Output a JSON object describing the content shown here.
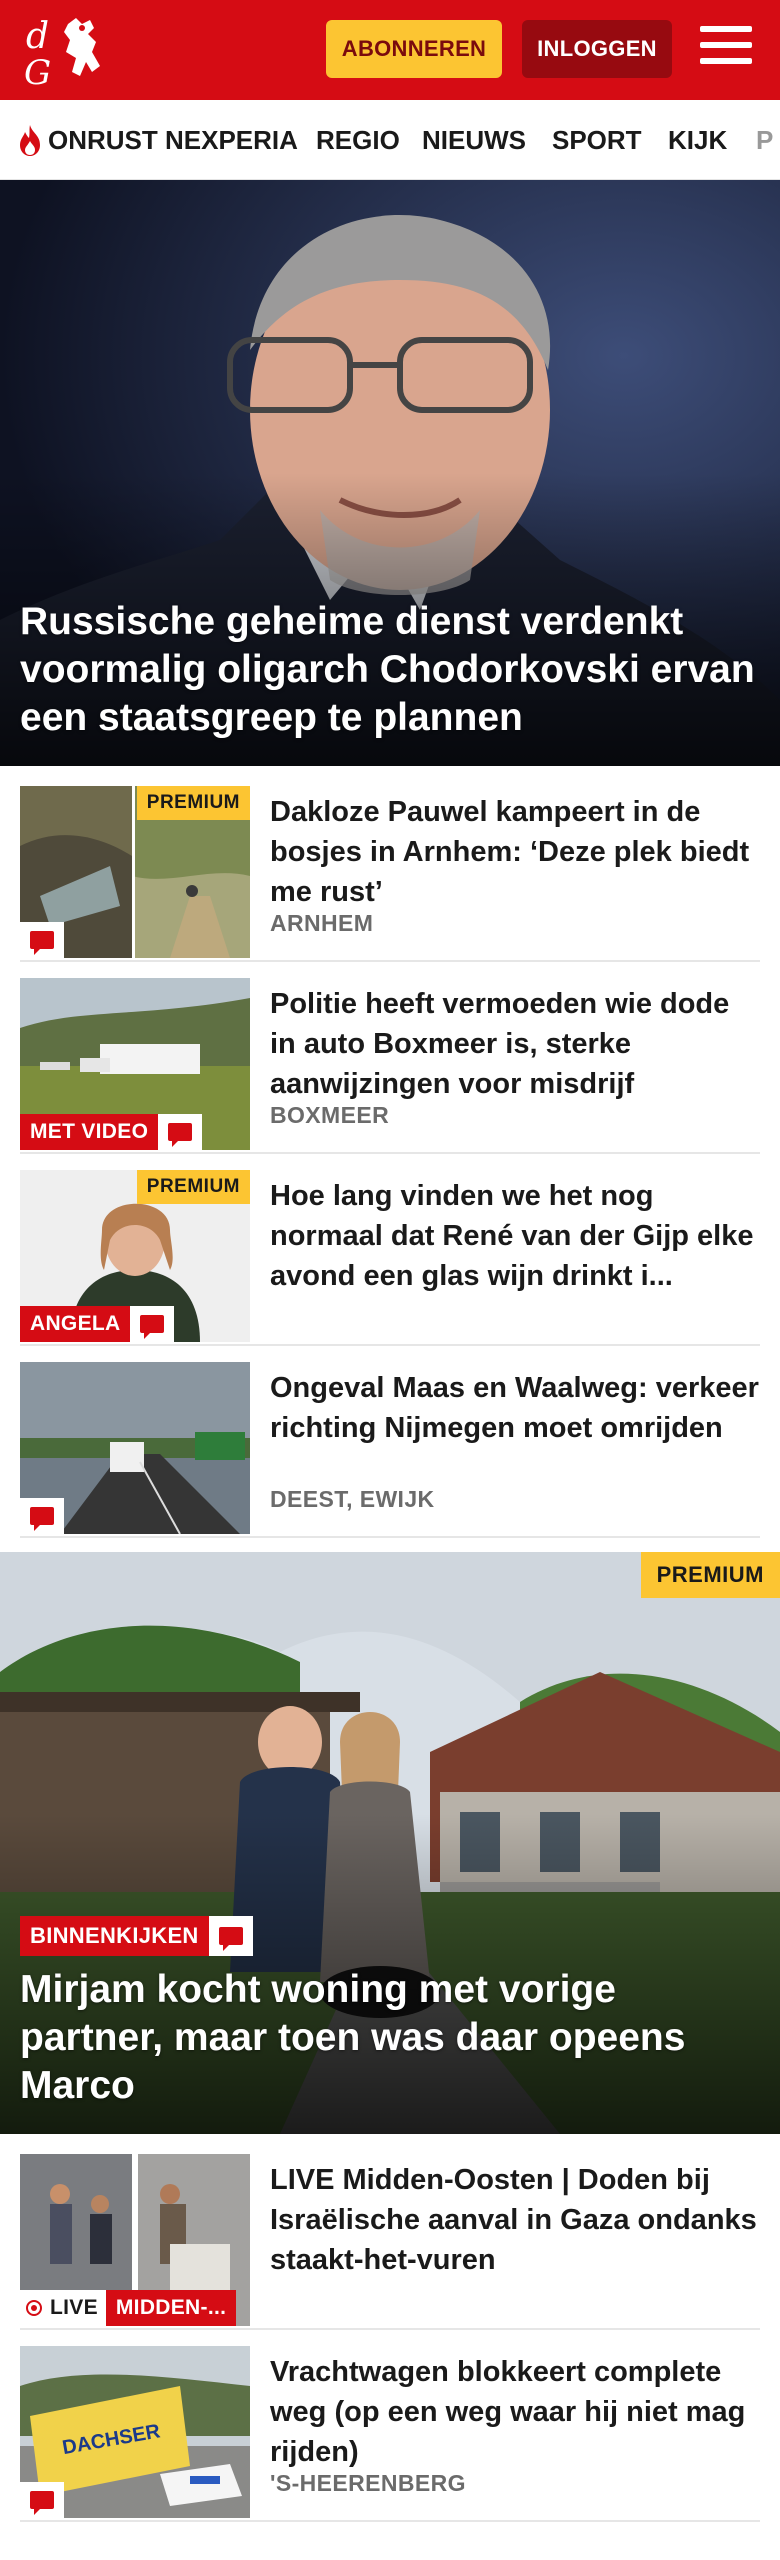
{
  "header": {
    "subscribe_label": "ABONNEREN",
    "login_label": "INLOGGEN"
  },
  "nav": {
    "items": [
      {
        "label": "ONRUST NEXPERIA",
        "icon": "flame-icon"
      },
      {
        "label": "REGIO"
      },
      {
        "label": "NIEUWS"
      },
      {
        "label": "SPORT"
      },
      {
        "label": "KIJK"
      },
      {
        "label": "P"
      }
    ]
  },
  "hero": {
    "title": "Russische geheime dienst verdenkt voormalig oligarch Chodorkovski ervan een staatsgreep te plannen"
  },
  "articles": [
    {
      "title": "Dakloze Pauwel kampeert in de bosjes in Arnhem: ‘Deze plek biedt me rust’",
      "location": "ARNHEM",
      "premium": "PREMIUM"
    },
    {
      "title": "Politie heeft vermoeden wie dode in auto Boxmeer is, sterke aanwijzingen voor misdrijf",
      "location": "BOXMEER",
      "tag": "MET VIDEO"
    },
    {
      "title": "Hoe lang vinden we het nog normaal dat René van der Gijp elke avond een glas wijn drinkt i...",
      "premium": "PREMIUM",
      "tag": "ANGELA"
    },
    {
      "title": "Ongeval Maas en Waalweg: verkeer richting Nijmegen moet omrijden",
      "location": "DEEST, EWIJK"
    }
  ],
  "feature": {
    "premium": "PREMIUM",
    "tag": "BINNENKIJKEN",
    "title": "Mirjam kocht woning met vorige partner, maar toen was daar opeens Marco"
  },
  "articles2": [
    {
      "title": "LIVE Midden-Oosten | Doden bij Israëlische aanval in Gaza ondanks staakt-het-vuren",
      "live": "LIVE",
      "tag": "MIDDEN-..."
    },
    {
      "title": "Vrachtwagen blokkeert complete weg (op een weg waar hij niet mag rijden)",
      "location": "'S-HEERENBERG",
      "truck_text": "DACHSER"
    }
  ],
  "colors": {
    "brand_red": "#d50c14",
    "premium_yellow": "#fcc532",
    "login_dark_red": "#970a10"
  }
}
